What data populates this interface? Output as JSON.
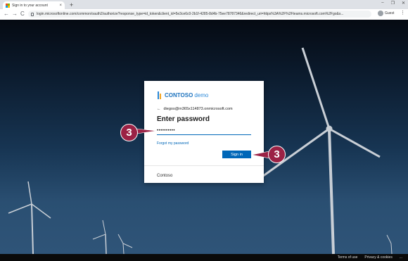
{
  "browser": {
    "tab_title": "Sign in to your account",
    "tab_close": "×",
    "new_tab": "+",
    "window_controls": [
      "–",
      "❐",
      "✕"
    ],
    "back": "←",
    "forward": "→",
    "reload": "C",
    "url": "login.microsoftonline.com/common/oauth2/authorize?response_type=id_token&client_id=5e3ce6c0-2b1f-4285-8d4b-75ee78787346&redirect_uri=https%3A%2F%2Fteams.microsoft.com%2Fgo&s...",
    "profile": "Guest",
    "menu": "⋮"
  },
  "signin": {
    "brand_name": "CONTOSO",
    "brand_suffix": "demo",
    "account_back": "←",
    "account_email": "diegos@m365x114873.onmicrosoft.com",
    "title": "Enter password",
    "password_value": "••••••••••",
    "forgot_link": "Forgot my password",
    "signin_button": "Sign in",
    "footer_text": "Contoso"
  },
  "callouts": [
    "3",
    "3"
  ],
  "footer": {
    "terms": "Terms of use",
    "privacy": "Privacy & cookies",
    "more": "..."
  },
  "colors": {
    "accent": "#0067b8",
    "callout": "#9b2245",
    "brand": "#1e73be"
  }
}
